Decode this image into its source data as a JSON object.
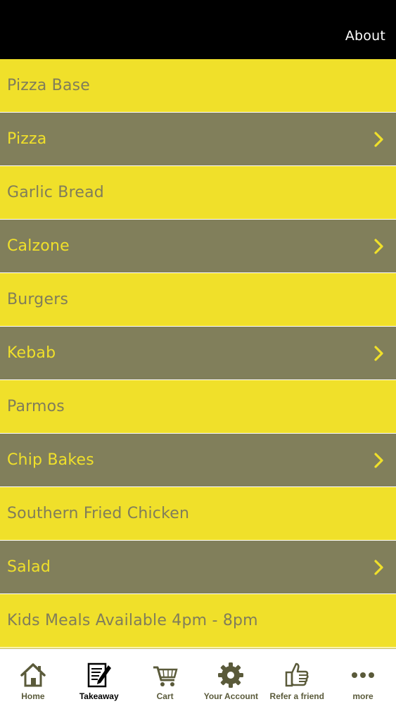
{
  "header": {
    "about_label": "About"
  },
  "menu": {
    "items": [
      {
        "label": "Pizza Base",
        "style": "light",
        "has_submenu": false
      },
      {
        "label": "Pizza",
        "style": "dark",
        "has_submenu": true
      },
      {
        "label": "Garlic Bread",
        "style": "light",
        "has_submenu": false
      },
      {
        "label": "Calzone",
        "style": "dark",
        "has_submenu": true
      },
      {
        "label": "Burgers",
        "style": "light",
        "has_submenu": false
      },
      {
        "label": "Kebab",
        "style": "dark",
        "has_submenu": true
      },
      {
        "label": "Parmos",
        "style": "light",
        "has_submenu": false
      },
      {
        "label": "Chip Bakes",
        "style": "dark",
        "has_submenu": true
      },
      {
        "label": "Southern Fried Chicken",
        "style": "light",
        "has_submenu": false
      },
      {
        "label": "Salad",
        "style": "dark",
        "has_submenu": true
      },
      {
        "label": "Kids Meals Available 4pm - 8pm",
        "style": "light",
        "has_submenu": false
      }
    ]
  },
  "tabbar": {
    "tabs": [
      {
        "label": "Home",
        "icon": "home-icon",
        "active": false
      },
      {
        "label": "Takeaway",
        "icon": "notepad-pencil-icon",
        "active": true
      },
      {
        "label": "Cart",
        "icon": "cart-icon",
        "active": false
      },
      {
        "label": "Your Account",
        "icon": "gear-icon",
        "active": false
      },
      {
        "label": "Refer a friend",
        "icon": "thumbs-up-icon",
        "active": false
      },
      {
        "label": "more",
        "icon": "more-dots-icon",
        "active": false
      }
    ]
  },
  "colors": {
    "header_bg": "#000000",
    "row_light_bg": "#f0e02a",
    "row_light_text": "#807d5a",
    "row_dark_bg": "#817f5b",
    "row_dark_text": "#f0e02a",
    "tab_icon": "#5a5a3a",
    "tab_active": "#000000"
  }
}
